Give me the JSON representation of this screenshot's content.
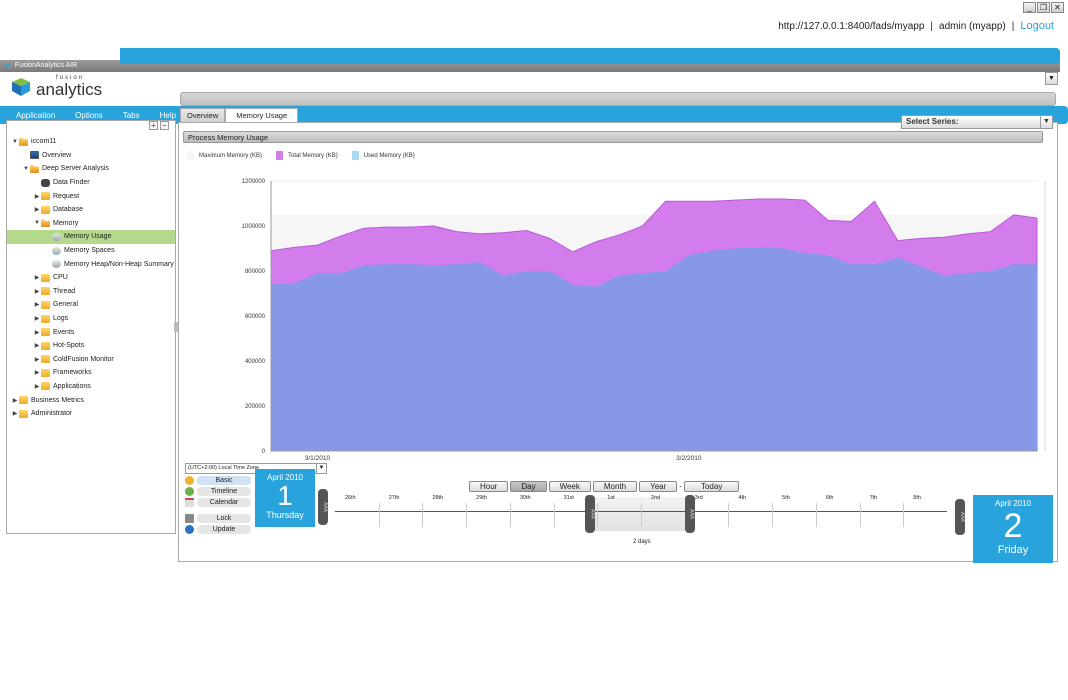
{
  "window": {
    "title": "FusionAnalytics AIR",
    "controls": [
      "_",
      "❐",
      "✕"
    ]
  },
  "session": {
    "url": "http://127.0.0.1:8400/fads/myapp",
    "separator": "|",
    "user": "admin (myapp)",
    "logout": "Logout"
  },
  "logo": {
    "small": "fusion",
    "big": "analytics"
  },
  "menu": [
    "Application",
    "Options",
    "Tabs",
    "Help"
  ],
  "sidebar": {
    "tools": [
      "+",
      "−"
    ],
    "tree": [
      {
        "label": "iccom11",
        "level": 0,
        "arrow": "▼",
        "icon": "folder-open"
      },
      {
        "label": "Overview",
        "level": 1,
        "arrow": "",
        "icon": "monitor"
      },
      {
        "label": "Deep Server Analysis",
        "level": 1,
        "arrow": "▼",
        "icon": "folder-open"
      },
      {
        "label": "Data Finder",
        "level": 2,
        "arrow": "",
        "icon": "binoc"
      },
      {
        "label": "Request",
        "level": 2,
        "arrow": "▶",
        "icon": "folder"
      },
      {
        "label": "Database",
        "level": 2,
        "arrow": "▶",
        "icon": "folder"
      },
      {
        "label": "Memory",
        "level": 2,
        "arrow": "▼",
        "icon": "folder-open"
      },
      {
        "label": "Memory Usage",
        "level": 3,
        "arrow": "",
        "icon": "page",
        "selected": true
      },
      {
        "label": "Memory Spaces",
        "level": 3,
        "arrow": "",
        "icon": "page"
      },
      {
        "label": "Memory Heap/Non-Heap Summary",
        "level": 3,
        "arrow": "",
        "icon": "page"
      },
      {
        "label": "CPU",
        "level": 2,
        "arrow": "▶",
        "icon": "folder"
      },
      {
        "label": "Thread",
        "level": 2,
        "arrow": "▶",
        "icon": "folder"
      },
      {
        "label": "General",
        "level": 2,
        "arrow": "▶",
        "icon": "folder"
      },
      {
        "label": "Logs",
        "level": 2,
        "arrow": "▶",
        "icon": "folder"
      },
      {
        "label": "Events",
        "level": 2,
        "arrow": "▶",
        "icon": "folder"
      },
      {
        "label": "Hot-Spots",
        "level": 2,
        "arrow": "▶",
        "icon": "folder"
      },
      {
        "label": "ColdFusion Monitor",
        "level": 2,
        "arrow": "▶",
        "icon": "folder"
      },
      {
        "label": "Frameworks",
        "level": 2,
        "arrow": "▶",
        "icon": "folder"
      },
      {
        "label": "Applications",
        "level": 2,
        "arrow": "▶",
        "icon": "folder"
      },
      {
        "label": "Business Metrics",
        "level": 0,
        "arrow": "▶",
        "icon": "folder"
      },
      {
        "label": "Administrator",
        "level": 0,
        "arrow": "▶",
        "icon": "folder"
      }
    ]
  },
  "tabs": [
    {
      "label": "Overview",
      "active": false
    },
    {
      "label": "Memory Usage",
      "active": true
    }
  ],
  "panel": {
    "title": "Process Memory Usage",
    "series_select": "Select Series:"
  },
  "colors": {
    "accent": "#29a3dc",
    "max_memory": "#f6f6f6",
    "total_memory": "#d37ded",
    "total_memory_line": "#b85ad8",
    "used_memory": "#8799e6",
    "used_memory_legend": "#a8dbf3",
    "selected_row": "#b5d98a"
  },
  "chart_data": {
    "type": "area",
    "title": "Process Memory Usage",
    "xlabel": "",
    "ylabel": "",
    "ylim": [
      0,
      1200000
    ],
    "yticks": [
      0,
      200000,
      400000,
      600000,
      800000,
      1000000,
      1200000
    ],
    "ytick_labels": [
      "0",
      "200000",
      "400000",
      "600000",
      "800000",
      "1000000",
      "1200000"
    ],
    "x_labels": [
      {
        "label": "3/1/2010",
        "index": 2
      },
      {
        "label": "3/2/2010",
        "index": 18
      }
    ],
    "grid": true,
    "legend_position": "top-left",
    "series": [
      {
        "name": "Maximum Memory (KB)",
        "values": [
          1050000,
          1050000,
          1050000,
          1050000,
          1050000,
          1050000,
          1050000,
          1050000,
          1050000,
          1050000,
          1050000,
          1050000,
          1050000,
          1050000,
          1050000,
          1050000,
          1050000,
          1050000,
          1050000,
          1050000,
          1050000,
          1050000,
          1050000,
          1050000,
          1050000,
          1050000,
          1050000,
          1050000,
          1050000,
          1050000,
          1050000,
          1050000,
          1050000,
          1050000
        ]
      },
      {
        "name": "Total Memory (KB)",
        "values": [
          890000,
          905000,
          915000,
          955000,
          990000,
          995000,
          995000,
          1000000,
          975000,
          965000,
          970000,
          980000,
          945000,
          885000,
          930000,
          960000,
          1000000,
          1110000,
          1110000,
          1110000,
          1115000,
          1120000,
          1120000,
          1115000,
          1025000,
          1020000,
          1110000,
          935000,
          945000,
          950000,
          965000,
          975000,
          1050000,
          1035000
        ]
      },
      {
        "name": "Used Memory (KB)",
        "values": [
          740000,
          745000,
          790000,
          790000,
          825000,
          830000,
          830000,
          825000,
          830000,
          840000,
          780000,
          800000,
          800000,
          740000,
          730000,
          780000,
          790000,
          800000,
          870000,
          890000,
          900000,
          905000,
          900000,
          880000,
          870000,
          830000,
          830000,
          860000,
          820000,
          780000,
          790000,
          800000,
          830000,
          830000
        ]
      }
    ]
  },
  "timezone": {
    "label": "(UTC+2:00) Local Time Zone"
  },
  "modes": [
    {
      "label": "Basic",
      "icon": "clock-icon",
      "active": true
    },
    {
      "label": "Timeline",
      "icon": "timeline-icon",
      "active": false
    },
    {
      "label": "Calendar",
      "icon": "calendar-icon",
      "active": false
    },
    {
      "label": "Lock",
      "icon": "lock-icon",
      "active": false
    },
    {
      "label": "Update",
      "icon": "refresh-icon",
      "active": false
    }
  ],
  "start_date": {
    "month": "April 2010",
    "day": "1",
    "weekday": "Thursday"
  },
  "end_date": {
    "month": "April 2010",
    "day": "2",
    "weekday": "Friday"
  },
  "scale_buttons": [
    {
      "label": "Hour",
      "active": false
    },
    {
      "label": "Day",
      "active": true
    },
    {
      "label": "Week",
      "active": false
    },
    {
      "label": "Month",
      "active": false
    },
    {
      "label": "Year",
      "active": false
    }
  ],
  "scale_sep": "-",
  "today_button": "Today",
  "timeline": {
    "days": [
      "26th",
      "27th",
      "28th",
      "29th",
      "30th",
      "31st",
      "1st",
      "2nd",
      "3rd",
      "4th",
      "5th",
      "6th",
      "7th",
      "8th"
    ],
    "range_label": "2 days",
    "handle_glyph": "AAA"
  }
}
